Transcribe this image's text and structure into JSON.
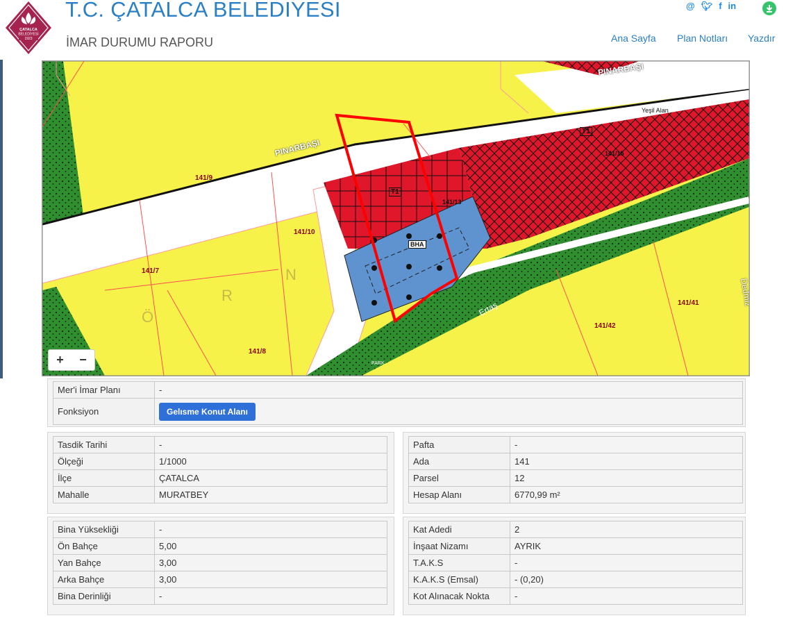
{
  "header": {
    "title": "T.C. ÇATALCA BELEDİYESİ",
    "subtitle": "İMAR DURUMU RAPORU",
    "logo_text": "ÇATALCA BELEDİYESİ 1923",
    "social": [
      "@",
      "𝕪",
      "f",
      "in"
    ],
    "nav": [
      "Ana Sayfa",
      "Plan Notları",
      "Yazdır"
    ]
  },
  "map": {
    "zoom_in": "+",
    "zoom_out": "−",
    "labels": {
      "street1": "PINARBAŞI",
      "street2": "PINARBAŞI",
      "street3": "Ertaş",
      "street4": "Dedmiz",
      "p1": "141/9",
      "p2": "141/10",
      "p3": "141/7",
      "p4": "141/8",
      "p5": "141/41",
      "p6": "141/42",
      "p7": "141/13",
      "p8": "141/15",
      "t1": "T1",
      "t2": "T1",
      "bha": "BHA",
      "r1": "Ö",
      "r2": "R",
      "r3": "N",
      "park": "PARK",
      "yesil": "Yeşil Alan"
    }
  },
  "plan": {
    "rows": [
      {
        "label": "Mer'i İmar Planı",
        "value": "-"
      },
      {
        "label": "Fonksiyon",
        "button": "Gelısme Konut Alanı"
      }
    ]
  },
  "left1": [
    {
      "label": "Tasdik Tarihi",
      "value": "-"
    },
    {
      "label": "Ölçeği",
      "value": "1/1000"
    },
    {
      "label": "İlçe",
      "value": "ÇATALCA"
    },
    {
      "label": "Mahalle",
      "value": "MURATBEY"
    }
  ],
  "right1": [
    {
      "label": "Pafta",
      "value": "-"
    },
    {
      "label": "Ada",
      "value": "141"
    },
    {
      "label": "Parsel",
      "value": "12"
    },
    {
      "label": "Hesap Alanı",
      "value": "6770,99 m²"
    }
  ],
  "left2": [
    {
      "label": "Bina Yüksekliği",
      "value": "-"
    },
    {
      "label": "Ön Bahçe",
      "value": "5,00"
    },
    {
      "label": "Yan Bahçe",
      "value": "3,00"
    },
    {
      "label": "Arka Bahçe",
      "value": "3,00"
    },
    {
      "label": "Bina Derinliği",
      "value": "-"
    }
  ],
  "right2": [
    {
      "label": "Kat Adedi",
      "value": "2"
    },
    {
      "label": "İnşaat Nizamı",
      "value": "AYRIK"
    },
    {
      "label": "T.A.K.S",
      "value": "-"
    },
    {
      "label": "K.A.K.S (Emsal)",
      "value": "- (0,20)"
    },
    {
      "label": "Kot Alınacak Nokta",
      "value": "-"
    }
  ],
  "colors": {
    "brand": "#2a7fc5",
    "logo": "#a5244f",
    "button": "#2e6fd8",
    "zone_red": "#e0162b",
    "zone_yellow": "#f6f24a",
    "zone_green": "#2f8f2f",
    "zone_blue": "#5f93d0"
  }
}
